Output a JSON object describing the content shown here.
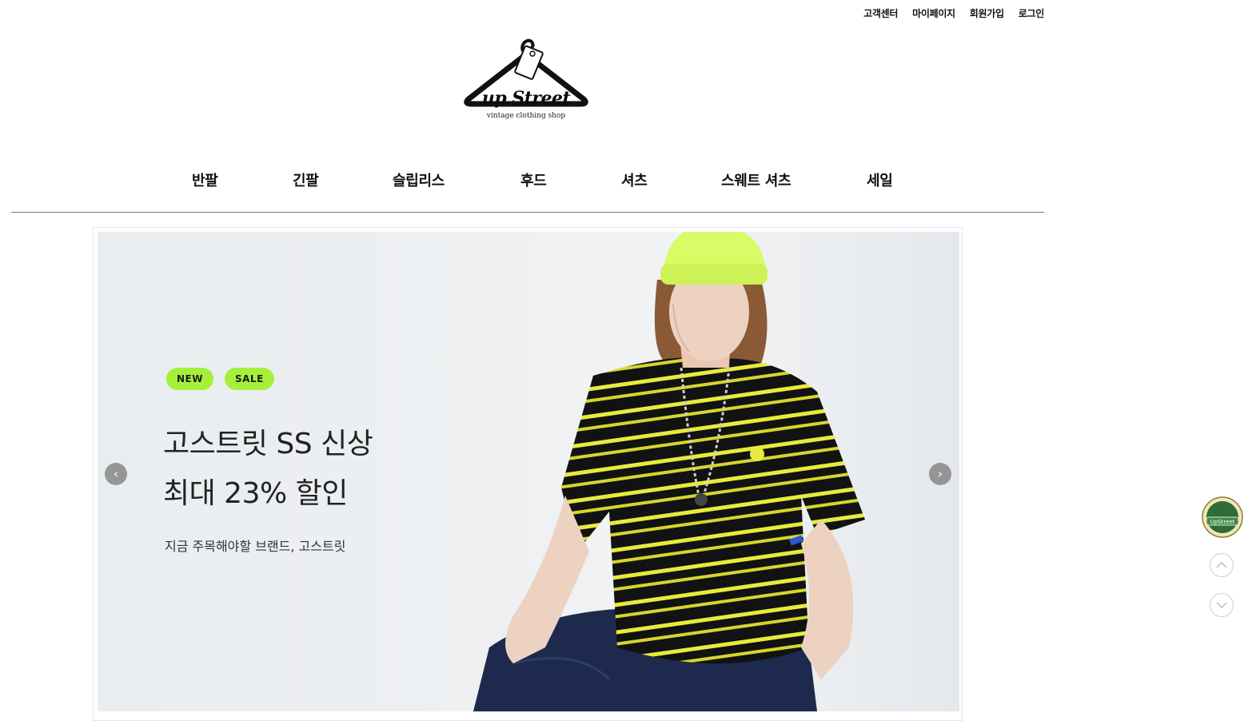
{
  "header": {
    "utility_links": [
      "고객센터",
      "마이페이지",
      "회원가입",
      "로그인"
    ],
    "logo": {
      "title": "up Street",
      "subtitle": "vintage clothing shop"
    }
  },
  "nav": {
    "items": [
      "반팔",
      "긴팔",
      "슬립리스",
      "후드",
      "셔츠",
      "스웨트 셔츠",
      "세일"
    ]
  },
  "banner": {
    "badges": [
      "NEW",
      "SALE"
    ],
    "headline_1": "고스트릿 SS 신상",
    "headline_2": "최대 23% 할인",
    "subtext": "지금 주목해야할 브랜드, 고스트릿",
    "prev_icon": "chevron-left-icon",
    "next_icon": "chevron-right-icon"
  },
  "floating": {
    "badge_label": "UpStreet",
    "up_icon": "chevron-up-icon",
    "down_icon": "chevron-down-icon"
  },
  "colors": {
    "badge_green": "#a6f03a",
    "beanie": "#d8fb66",
    "shirt_stripe": "#e9ea3e",
    "shirt_base": "#121212",
    "denim": "#1d2a4d"
  }
}
